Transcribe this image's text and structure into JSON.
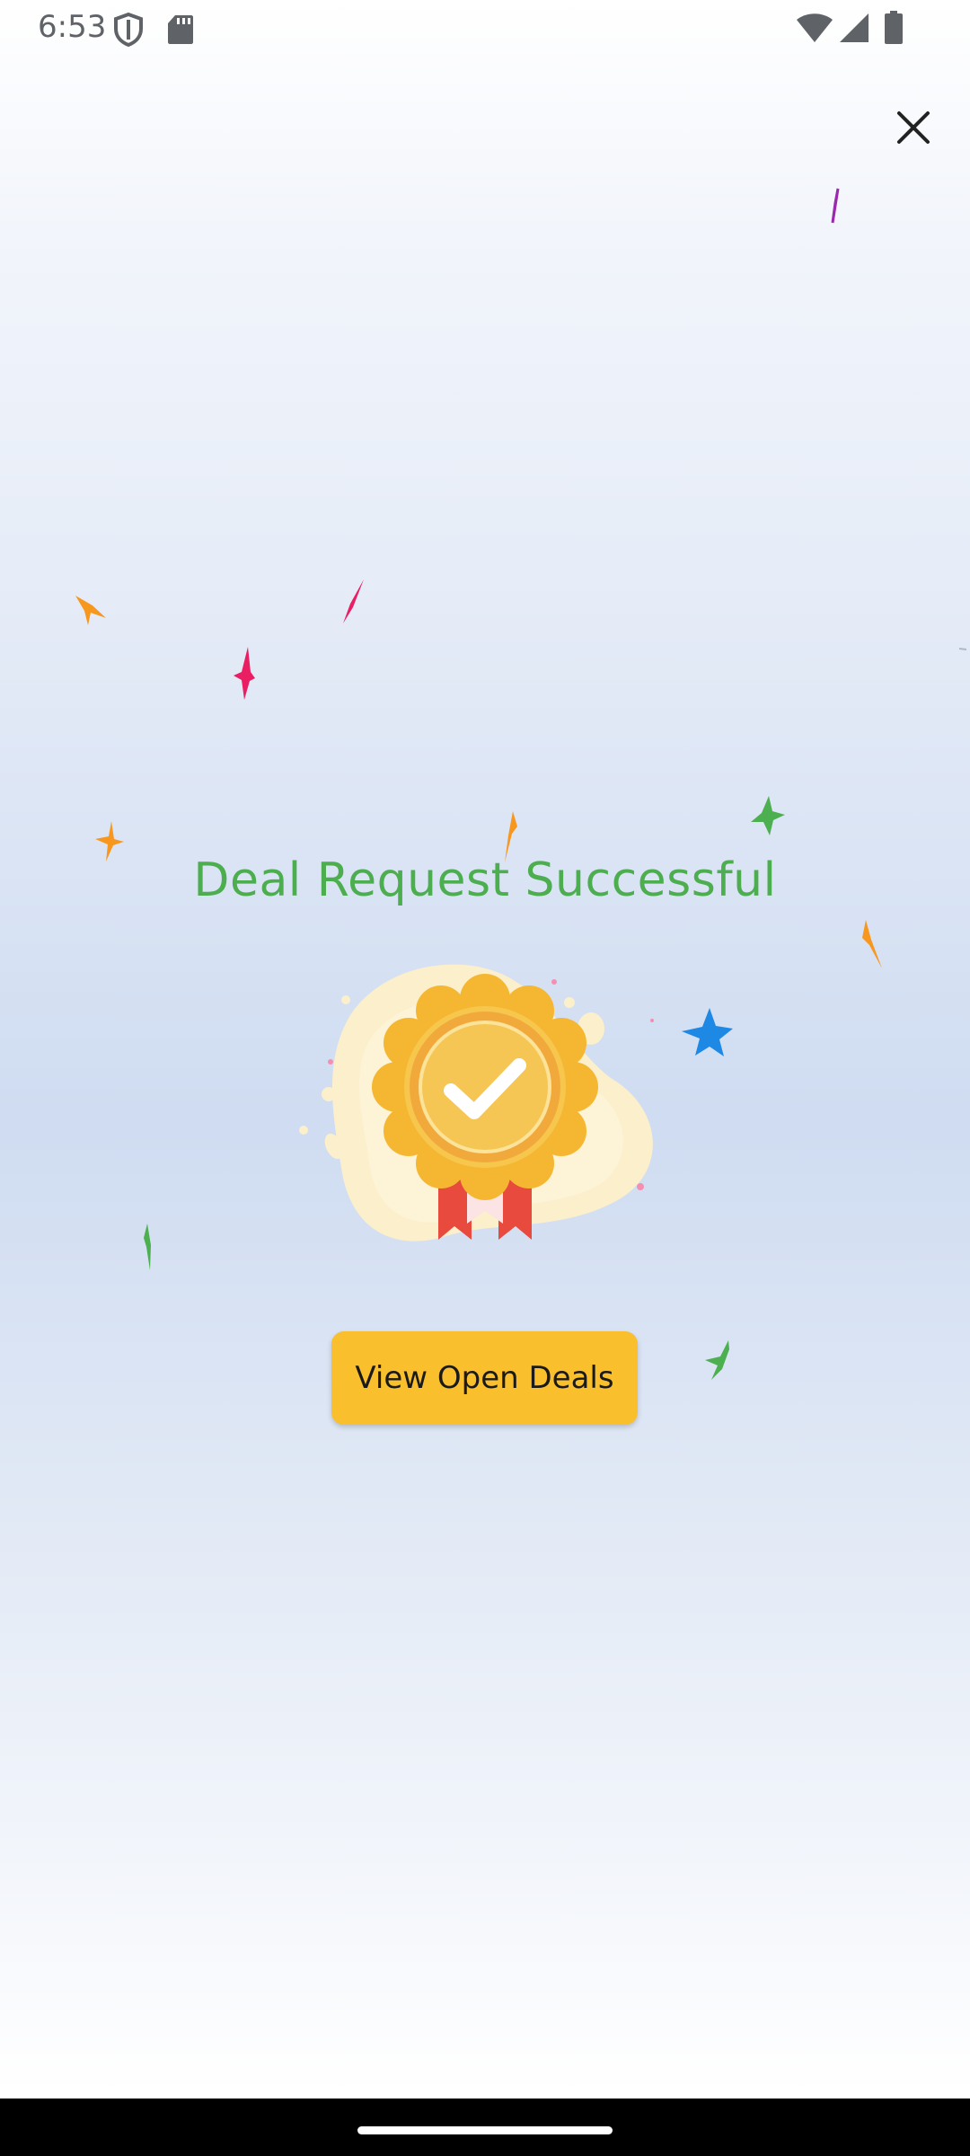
{
  "status_bar": {
    "time": "6:53",
    "icons": [
      "shield-icon",
      "sd-card-icon",
      "wifi-icon",
      "signal-icon",
      "battery-icon"
    ]
  },
  "close_button": {
    "icon": "close-icon"
  },
  "dialog": {
    "title": "Deal Request Successful",
    "illustration": "medal-check-icon",
    "button_label": "View Open Deals"
  },
  "colors": {
    "title": "#4cae4f",
    "button": "#f9bf2c",
    "medal_gold": "#f5b731",
    "ribbon_red": "#e84a3d",
    "confetti": [
      "#f7971e",
      "#e91e63",
      "#4caf50",
      "#1e88e5",
      "#9c27b0"
    ]
  }
}
